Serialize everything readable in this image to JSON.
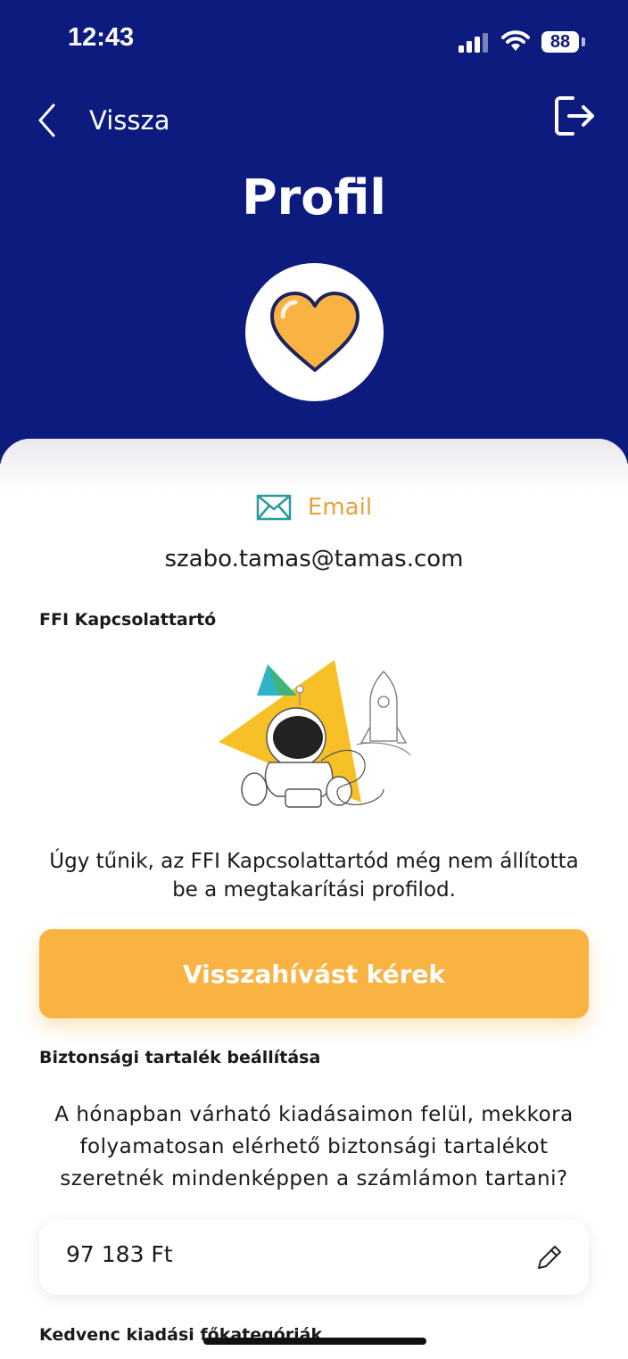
{
  "status_bar": {
    "time": "12:43",
    "battery": "88"
  },
  "nav": {
    "back_label": "Vissza",
    "title": "Profil"
  },
  "email": {
    "label": "Email",
    "value": "szabo.tamas@tamas.com"
  },
  "advisor": {
    "heading": "FFI Kapcsolattartó",
    "notice_line1": "Úgy tűnik, az FFI Kapcsolattartód még nem állította",
    "notice_line2": "be a megtakarítási profilod.",
    "button_label": "Visszahívást kérek"
  },
  "reserve": {
    "heading": "Biztonsági tartalék beállítása",
    "question_line1": "A hónapban várható kiadásaimon felül, mekkora",
    "question_line2": "folyamatosan elérhető biztonsági tartalékot",
    "question_line3": "szeretnék mindenképpen a számlámon tartani?",
    "amount": "97 183 Ft"
  },
  "categories": {
    "heading": "Kedvenc kiadási főkategóriák"
  },
  "colors": {
    "header_bg": "#0d1a7e",
    "accent": "#f9b343",
    "email_icon": "#2a9a9a"
  }
}
